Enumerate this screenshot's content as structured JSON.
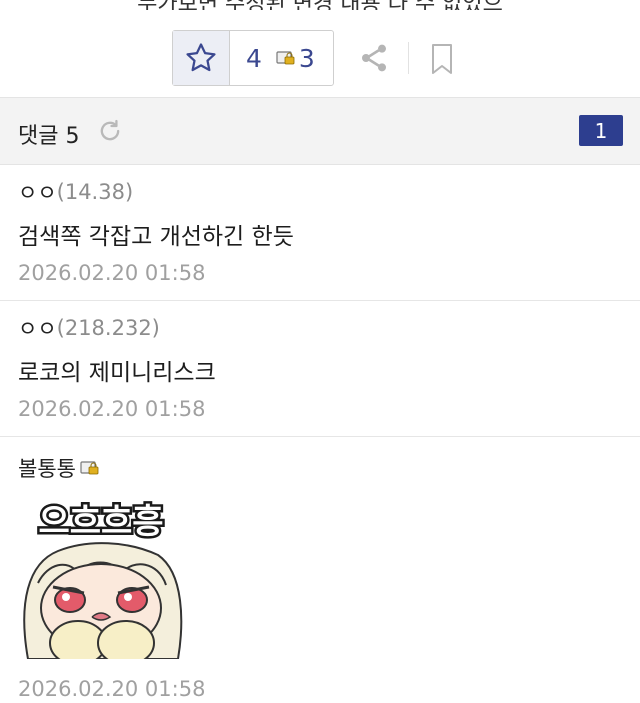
{
  "cut_text": "누가보면 수정된 변경 내용 다 수 없었으",
  "actions": {
    "vote_count": "4",
    "fixed_vote_count": "3",
    "icons": [
      "star-icon",
      "lock-badge-icon",
      "share-icon",
      "bookmark-icon"
    ]
  },
  "comments_header": {
    "title": "댓글 5",
    "page": "1",
    "refresh_icon": "refresh-icon"
  },
  "comments": [
    {
      "nick": "ㅇㅇ",
      "ip": "(14.38)",
      "text": "검색쪽 각잡고 개선하긴 한듯",
      "date": "2026.02.20 01:58"
    },
    {
      "nick": "ㅇㅇ",
      "ip": "(218.232)",
      "text": "로코의 제미니리스크",
      "date": "2026.02.20 01:58"
    },
    {
      "nick": "볼통통",
      "ip": "",
      "text": "",
      "dccon_text": "으흐흐흥",
      "date": "2026.02.20 01:58"
    }
  ],
  "colors": {
    "accent": "#3b4890",
    "badge": "#2d3e8f",
    "muted": "#a0a0a0"
  }
}
